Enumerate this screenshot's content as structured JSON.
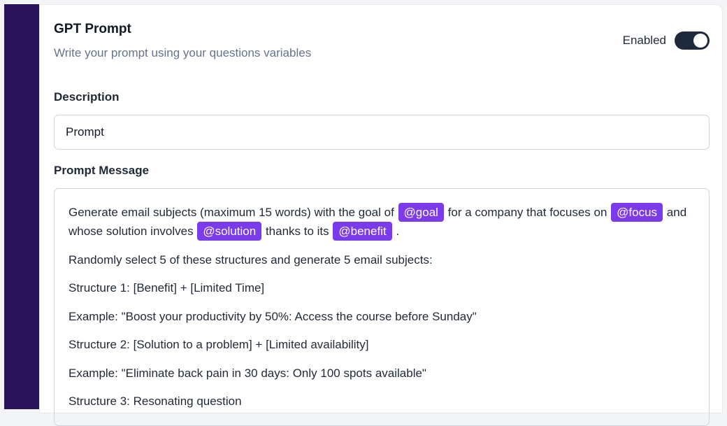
{
  "card": {
    "title": "GPT Prompt",
    "subtitle": "Write your prompt using your questions variables",
    "toggle_label": "Enabled",
    "toggle_on": true
  },
  "description": {
    "label": "Description",
    "value": "Prompt"
  },
  "prompt_message": {
    "label": "Prompt Message",
    "intro": {
      "p1": "Generate email subjects (maximum 15 words) with the goal of",
      "var_goal": "@goal",
      "p2": "for a company that focuses on",
      "var_focus": "@focus",
      "p3": "and whose solution involves",
      "var_solution": "@solution",
      "p4": "thanks to its",
      "var_benefit": "@benefit",
      "p5": "."
    },
    "lines": [
      "Randomly select 5 of these structures and generate 5 email subjects:",
      "Structure 1: [Benefit] + [Limited Time]",
      "Example: \"Boost your productivity by 50%: Access the course before Sunday\"",
      "Structure 2: [Solution to a problem] + [Limited availability]",
      "Example: \"Eliminate back pain in 30 days: Only 100 spots available\"",
      "Structure 3: Resonating question"
    ]
  },
  "colors": {
    "sidebar": "#2a1358",
    "chip": "#7c3aed",
    "toggle": "#1e293b"
  }
}
